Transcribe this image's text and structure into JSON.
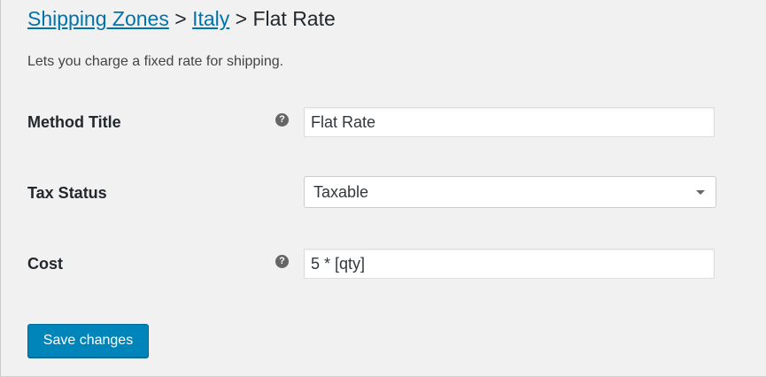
{
  "breadcrumb": {
    "zones_link": "Shipping Zones",
    "separator": ">",
    "zone_link": "Italy",
    "current": "Flat Rate"
  },
  "description": "Lets you charge a fixed rate for shipping.",
  "fields": {
    "method_title": {
      "label": "Method Title",
      "value": "Flat Rate",
      "help_icon": "?"
    },
    "tax_status": {
      "label": "Tax Status",
      "selected": "Taxable"
    },
    "cost": {
      "label": "Cost",
      "value": "5 * [qty]",
      "help_icon": "?"
    }
  },
  "actions": {
    "save_label": "Save changes"
  },
  "colors": {
    "link": "#0073aa",
    "primary_button": "#0085ba",
    "background": "#f1f1f1"
  }
}
